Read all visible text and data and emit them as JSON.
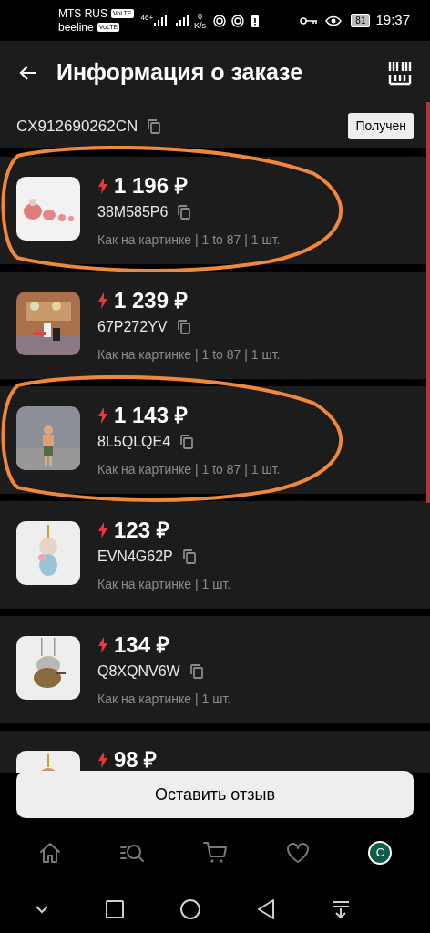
{
  "status_bar": {
    "carrier_1": "MTS RUS",
    "carrier_2": "beeline",
    "volte_1": "VoLTE",
    "volte_2": "VoLTE",
    "network": "46+",
    "speed_value": "0",
    "speed_unit": "K/s",
    "battery": "81",
    "time": "19:37"
  },
  "header": {
    "title": "Информация о заказе"
  },
  "order": {
    "number": "CX912690262CN",
    "status": "Получен"
  },
  "items": [
    {
      "price": "1 196 ₽",
      "code": "38M585P6",
      "meta": "Как на картинке | 1 to 87 | 1 шт.",
      "circled": true
    },
    {
      "price": "1 239 ₽",
      "code": "67P272YV",
      "meta": "Как на картинке | 1 to 87 | 1 шт.",
      "circled": false
    },
    {
      "price": "1 143 ₽",
      "code": "8L5QLQE4",
      "meta": "Как на картинке | 1 to 87 | 1 шт.",
      "circled": true
    },
    {
      "price": "123 ₽",
      "code": "EVN4G62P",
      "meta": "Как на картинке | 1 шт.",
      "circled": false
    },
    {
      "price": "134 ₽",
      "code": "Q8XQNV6W",
      "meta": "Как на картинке | 1 шт.",
      "circled": false
    },
    {
      "price": "98 ₽",
      "circled": false
    }
  ],
  "review_button": "Оставить отзыв",
  "bottom_nav": [
    {
      "kind": "home"
    },
    {
      "kind": "catalog"
    },
    {
      "kind": "cart"
    },
    {
      "kind": "favorites"
    },
    {
      "kind": "avatar",
      "label": "C"
    }
  ],
  "system_nav": [
    {
      "kind": "hide"
    },
    {
      "kind": "recents"
    },
    {
      "kind": "home"
    },
    {
      "kind": "back"
    },
    {
      "kind": "notifications"
    }
  ]
}
